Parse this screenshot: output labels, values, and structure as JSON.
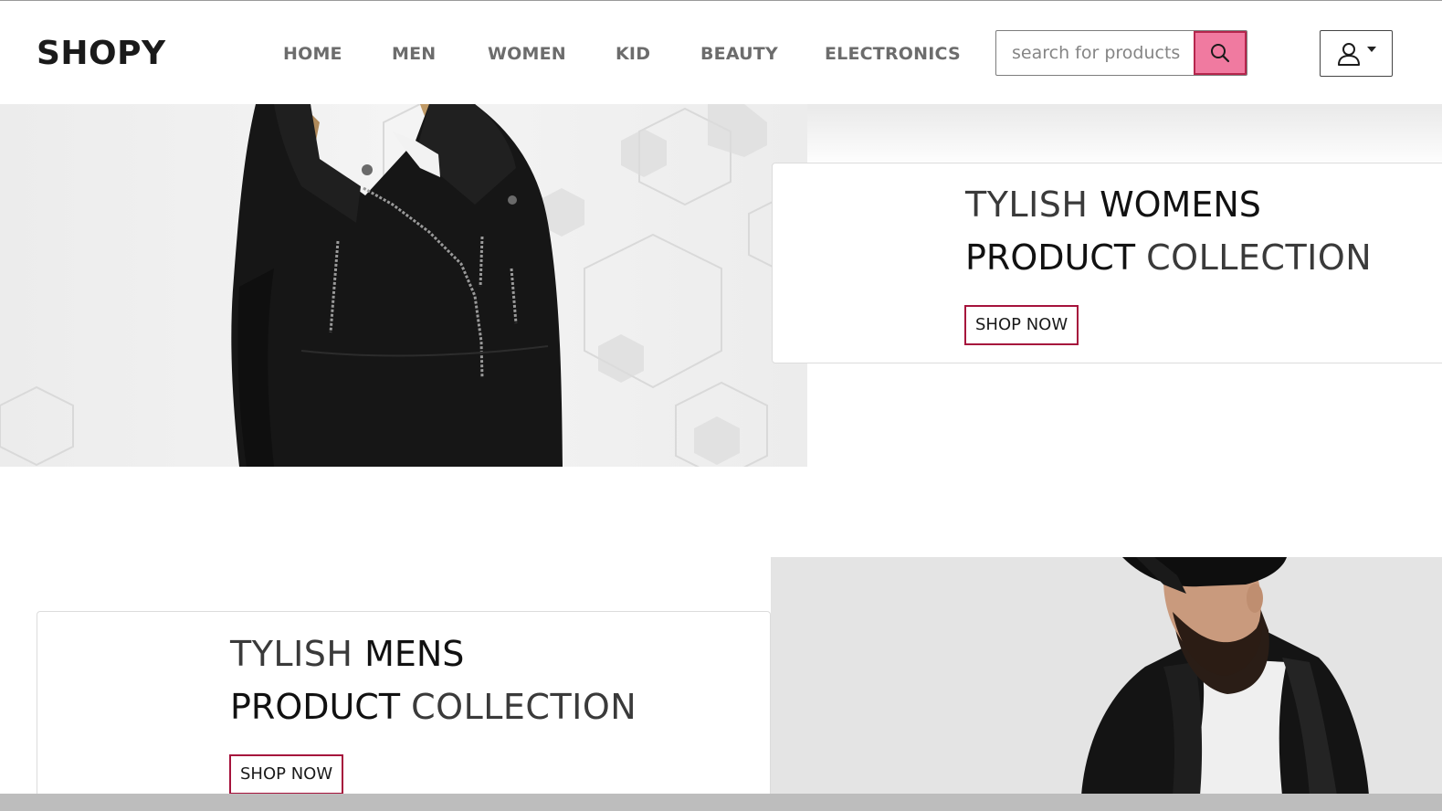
{
  "header": {
    "brand": "SHOPY",
    "nav": [
      {
        "label": "HOME"
      },
      {
        "label": "MEN"
      },
      {
        "label": "WOMEN"
      },
      {
        "label": "KID"
      },
      {
        "label": "BEAUTY"
      },
      {
        "label": "ELECTRONICS"
      }
    ],
    "search": {
      "placeholder": "search for products",
      "value": "",
      "button_icon": "search-icon"
    },
    "account": {
      "icon": "user-icon",
      "dropdown_icon": "caret-down-icon"
    }
  },
  "promos": [
    {
      "line1_light": "TYLISH ",
      "line1_strong": "WOMENS",
      "line2_strong": "PRODUCT ",
      "line2_light": "COLLECTION",
      "button": "SHOP NOW",
      "image": "woman-black-jacket-photo"
    },
    {
      "line1_light": "TYLISH ",
      "line1_strong": "MENS",
      "line2_strong": "PRODUCT ",
      "line2_light": "COLLECTION",
      "button": "SHOP NOW",
      "image": "bearded-man-cap-photo"
    }
  ],
  "colors": {
    "accent": "#f07aa0",
    "button_border": "#a6133c",
    "nav_text": "#6c6c6c"
  }
}
